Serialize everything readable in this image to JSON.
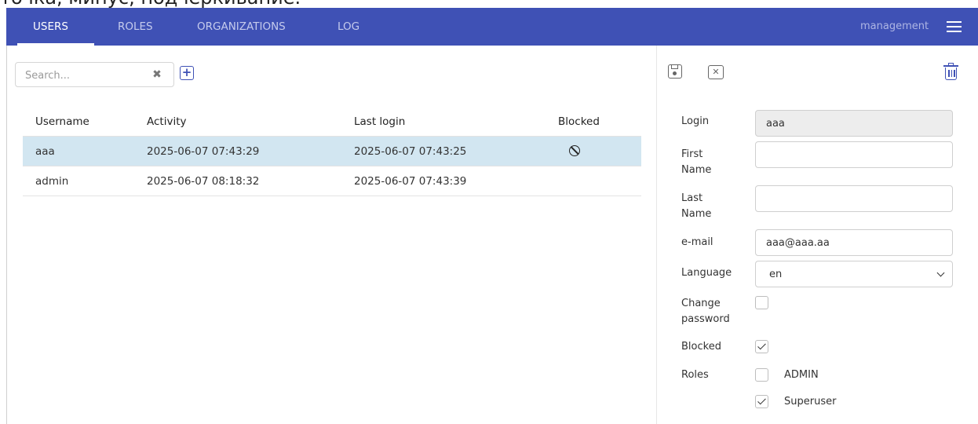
{
  "top_text": "точка, минус, подчеркивание.",
  "nav": {
    "tabs": [
      {
        "label": "USERS",
        "active": true
      },
      {
        "label": "ROLES",
        "active": false
      },
      {
        "label": "ORGANIZATIONS",
        "active": false
      },
      {
        "label": "LOG",
        "active": false
      }
    ],
    "user": "management",
    "menu_icon": "hamburger-menu-icon"
  },
  "search": {
    "placeholder": "Search...",
    "value": ""
  },
  "users_table": {
    "headers": [
      "Username",
      "Activity",
      "Last login",
      "Blocked"
    ],
    "rows": [
      {
        "username": "aaa",
        "activity": "2025-06-07 07:43:29",
        "last_login": "2025-06-07 07:43:25",
        "blocked": true,
        "selected": true
      },
      {
        "username": "admin",
        "activity": "2025-06-07 08:18:32",
        "last_login": "2025-06-07 07:43:39",
        "blocked": false,
        "selected": false
      }
    ]
  },
  "form": {
    "login_label": "Login",
    "login_value": "aaa",
    "first_name_label_1": "First",
    "first_name_label_2": "Name",
    "first_name_value": "",
    "last_name_label_1": "Last",
    "last_name_label_2": "Name",
    "last_name_value": "",
    "email_label": "e-mail",
    "email_value": "aaa@aaa.aa",
    "language_label": "Language",
    "language_value": "en",
    "change_password_label_1": "Change",
    "change_password_label_2": "password",
    "change_password_checked": false,
    "blocked_label": "Blocked",
    "blocked_checked": true,
    "roles_label": "Roles",
    "roles": [
      {
        "name": "ADMIN",
        "checked": false
      },
      {
        "name": "Superuser",
        "checked": true
      }
    ]
  },
  "colors": {
    "navbar": "#3f51b5",
    "selected_row": "#d2e6f1",
    "accent": "#3f51b5"
  }
}
